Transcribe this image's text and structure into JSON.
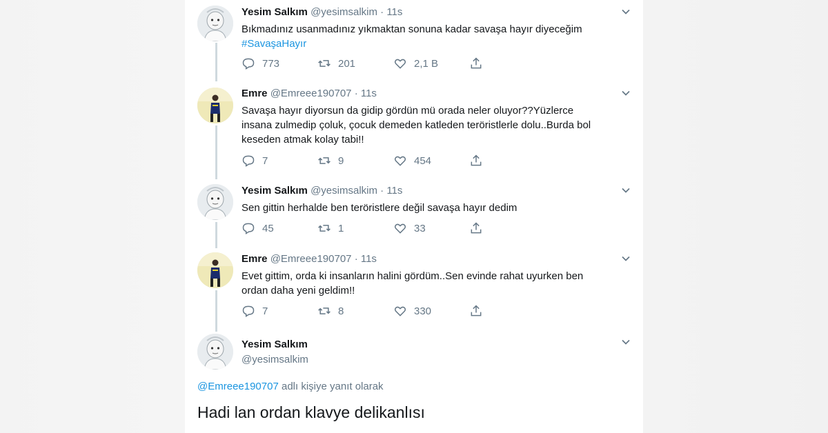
{
  "tweets": [
    {
      "name": "Yesim Salkım",
      "handle": "@yesimsalkim",
      "time": "11s",
      "text": "Bıkmadınız usanmadınız yıkmaktan sonuna kadar savaşa hayır diyeceğim",
      "hashtag": "#SavaşaHayır",
      "replies": "773",
      "retweets": "201",
      "likes": "2,1 B",
      "avatar": "baby-portrait"
    },
    {
      "name": "Emre",
      "handle": "@Emreee190707",
      "time": "11s",
      "text": "Savaşa hayır diyorsun da gidip gördün mü orada neler oluyor??Yüzlerce\ninsana zulmedip çoluk, çocuk demeden katleden teröristlerle dolu..Burda bol\nkeseden atmak kolay tabi!!",
      "replies": "7",
      "retweets": "9",
      "likes": "454",
      "avatar": "man-standing"
    },
    {
      "name": "Yesim Salkım",
      "handle": "@yesimsalkim",
      "time": "11s",
      "text": "Sen gittin herhalde ben teröristlere değil savaşa hayır dedim",
      "replies": "45",
      "retweets": "1",
      "likes": "33",
      "avatar": "baby-portrait"
    },
    {
      "name": "Emre",
      "handle": "@Emreee190707",
      "time": "11s",
      "text": "Evet gittim, orda ki insanların halini gördüm..Sen evinde rahat uyurken ben\nordan daha yeni geldim!!",
      "replies": "7",
      "retweets": "8",
      "likes": "330",
      "avatar": "man-standing"
    }
  ],
  "focused": {
    "name": "Yesim Salkım",
    "handle": "@yesimsalkim",
    "reply_mention": "@Emreee190707",
    "reply_suffix": " adlı kişiye yanıt olarak",
    "text": "Hadi lan ordan klavye delikanlısı",
    "avatar": "baby-portrait"
  },
  "icons": {
    "reply": "speech-bubble-icon",
    "retweet": "retweet-arrows-icon",
    "like": "heart-icon",
    "share": "share-upload-icon",
    "more": "chevron-down-icon"
  },
  "colors": {
    "text": "#14171a",
    "muted": "#657786",
    "link": "#1b95e0",
    "thread_line": "#cfd9de"
  }
}
